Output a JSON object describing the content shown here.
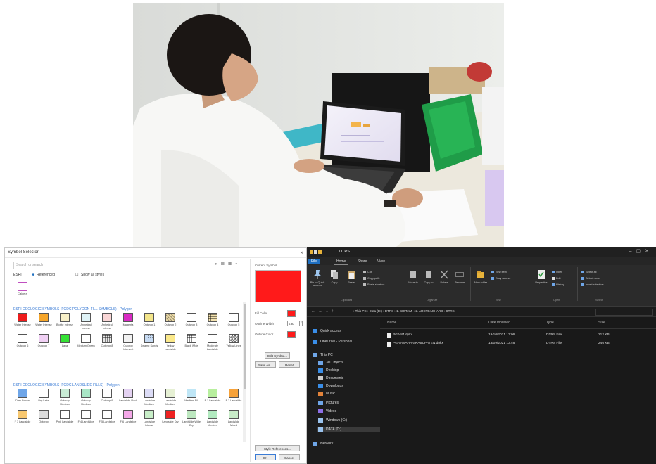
{
  "symbol_selector": {
    "title": "Symbol Selector",
    "search_placeholder": "Search or search",
    "close_glyph": "×",
    "tool_glyphs": "⌕ ▤ ▦ ▾",
    "filter": {
      "style_label": "ESRI",
      "show_label": "Referenced",
      "checkbox_label": "Show all styles"
    },
    "top_swatch_label": "Caldera",
    "group1_title": "ESRI GEOLOGIC SYMBOLS (FGDC POLYGON FILL SYMBOLS) - Polygon",
    "group2_title": "ESRI GEOLOGIC SYMBOLS (FGDC LANDSLIDE FILLS) - Polygon",
    "group1": [
      {
        "label": "Water Intense",
        "color": "#ee1c1c",
        "pattern": "solid"
      },
      {
        "label": "Water Intense",
        "color": "#f5a52a",
        "pattern": "solid"
      },
      {
        "label": "Biotite Intense",
        "color": "#f8f0c8",
        "pattern": "solid"
      },
      {
        "label": "Anhedral Intense",
        "color": "#e0f4f8",
        "pattern": "solid"
      },
      {
        "label": "Anhedral Intense",
        "color": "#f9d6d6",
        "pattern": "solid"
      },
      {
        "label": "Magenta",
        "color": "#d92bc4",
        "pattern": "solid"
      },
      {
        "label": "Outcrop 1",
        "color": "#f3e58a",
        "pattern": "solid"
      },
      {
        "label": "Outcrop 2",
        "color": "#e9d8a6",
        "pattern": "hatch"
      },
      {
        "label": "Outcrop 3",
        "color": "#ffffff",
        "pattern": "solid"
      },
      {
        "label": "Outcrop 4",
        "color": "#f4e3b0",
        "pattern": "grid"
      },
      {
        "label": "Outcrop 5",
        "color": "#ffffff",
        "pattern": "solid"
      },
      {
        "label": "Outcrop 6",
        "color": "#ffffff",
        "pattern": "solid"
      },
      {
        "label": "Outcrop 7",
        "color": "#f0d0f4",
        "pattern": "solid"
      },
      {
        "label": "Lava",
        "color": "#35e235",
        "pattern": "solid"
      },
      {
        "label": "Medium Green",
        "color": "#ffffff",
        "pattern": "solid"
      },
      {
        "label": "Outcrop 8",
        "color": "#e8e8e8",
        "pattern": "grid"
      },
      {
        "label": "Outcrop Intersect",
        "color": "#f2f2f2",
        "pattern": "solid"
      },
      {
        "label": "Swamp Sands",
        "color": "#c8dcf4",
        "pattern": "dots"
      },
      {
        "label": "Yellow Landslide",
        "color": "#fbe98a",
        "pattern": "solid"
      },
      {
        "label": "Black Wide",
        "color": "#ffffff",
        "pattern": "grid"
      },
      {
        "label": "Moderate Landslide",
        "color": "#ffffff",
        "pattern": "solid"
      },
      {
        "label": "Yellow Lines",
        "color": "#ffffff",
        "pattern": "cross"
      }
    ],
    "group2": [
      {
        "label": "Dark Brown",
        "color": "#6fa6e8"
      },
      {
        "label": "Dry Lake",
        "color": "#ffffff"
      },
      {
        "label": "Outcrop Medium",
        "color": "#c9ecd6"
      },
      {
        "label": "Outcrop Medium",
        "color": "#a9e6c6"
      },
      {
        "label": "Outcrop 9",
        "color": "#ffffff"
      },
      {
        "label": "Landslide Rock",
        "color": "#e4d2f2"
      },
      {
        "label": "Landslide Medium",
        "color": "#dcdcf6"
      },
      {
        "label": "Landslide Medium",
        "color": "#e6f0d4"
      },
      {
        "label": "Medium Fill",
        "color": "#bfe6f6"
      },
      {
        "label": "F 1 Landslide",
        "color": "#b8ef9e"
      },
      {
        "label": "F 2 Landslide",
        "color": "#f6a23a"
      },
      {
        "label": "F 3 Landslide",
        "color": "#f8c870"
      },
      {
        "label": "Outcrop",
        "color": "#dcdcdc"
      },
      {
        "label": "Pink Landslide",
        "color": "#ffffff"
      },
      {
        "label": "F 4 Landslide",
        "color": "#ffffff"
      },
      {
        "label": "F 5 Landslide",
        "color": "#ffffff"
      },
      {
        "label": "F 6 Landslide",
        "color": "#f4a8e8"
      },
      {
        "label": "Landslide Intense",
        "color": "#c8eec8"
      },
      {
        "label": "Landslide Dry",
        "color": "#ee2222"
      },
      {
        "label": "Landslide Wide Dry",
        "color": "#bde8c0"
      },
      {
        "label": "Landslide Medium",
        "color": "#b2eac0"
      },
      {
        "label": "Landslide Mixed",
        "color": "#c8ecc8"
      }
    ],
    "current_symbol_label": "Current Symbol",
    "fill_color_label": "Fill Color",
    "outline_width_label": "Outline Width",
    "outline_width_value": "0.40",
    "outline_color_label": "Outline Color",
    "fill_color": "#ff1a1a",
    "edit_symbol_label": "Edit Symbol...",
    "save_as_label": "Save As...",
    "reset_label": "Reset",
    "style_refs_label": "Style References...",
    "ok_label": "OK",
    "cancel_label": "Cancel"
  },
  "explorer": {
    "window_title": "DTRS",
    "tabs": [
      "File",
      "Home",
      "Share",
      "View"
    ],
    "ribbon": {
      "pin": "Pin to Quick access",
      "copy": "Copy",
      "paste": "Paste",
      "cut": "Cut",
      "copy_path": "Copy path",
      "paste_shortcut": "Paste shortcut",
      "move_to": "Move to",
      "copy_to": "Copy to",
      "delete": "Delete",
      "rename": "Rename",
      "new_folder": "New folder",
      "new_item": "New item",
      "easy_access": "Easy access",
      "properties": "Properties",
      "open": "Open",
      "edit": "Edit",
      "history": "History",
      "select_all": "Select all",
      "select_none": "Select none",
      "invert_selection": "Invert selection",
      "groups": [
        "Clipboard",
        "Organize",
        "New",
        "Open",
        "Select"
      ]
    },
    "address": "›  This PC  ›  Data (D:)  ›  DTRS  ›  1. SIGTAMI  ›  2. ARCTDASHARD  ›  DTRS",
    "nav": [
      "Quick access",
      "OneDrive - Personal",
      "This PC",
      "3D Objects",
      "Desktop",
      "Documents",
      "Downloads",
      "Music",
      "Pictures",
      "Videos",
      "Windows (C:)",
      "DATA (D:)",
      "Network"
    ],
    "columns": [
      "Name",
      "Date modified",
      "Type",
      "Size"
    ],
    "files": [
      {
        "name": "PGA 84.dpkx",
        "date": "19/10/2021 13:06",
        "type": "DTRS File",
        "size": "212 KB"
      },
      {
        "name": "PGA ASAHAN KABUPATEN.dpkx",
        "date": "13/09/2021 13:46",
        "type": "DTRS File",
        "size": "246 KB"
      }
    ]
  }
}
